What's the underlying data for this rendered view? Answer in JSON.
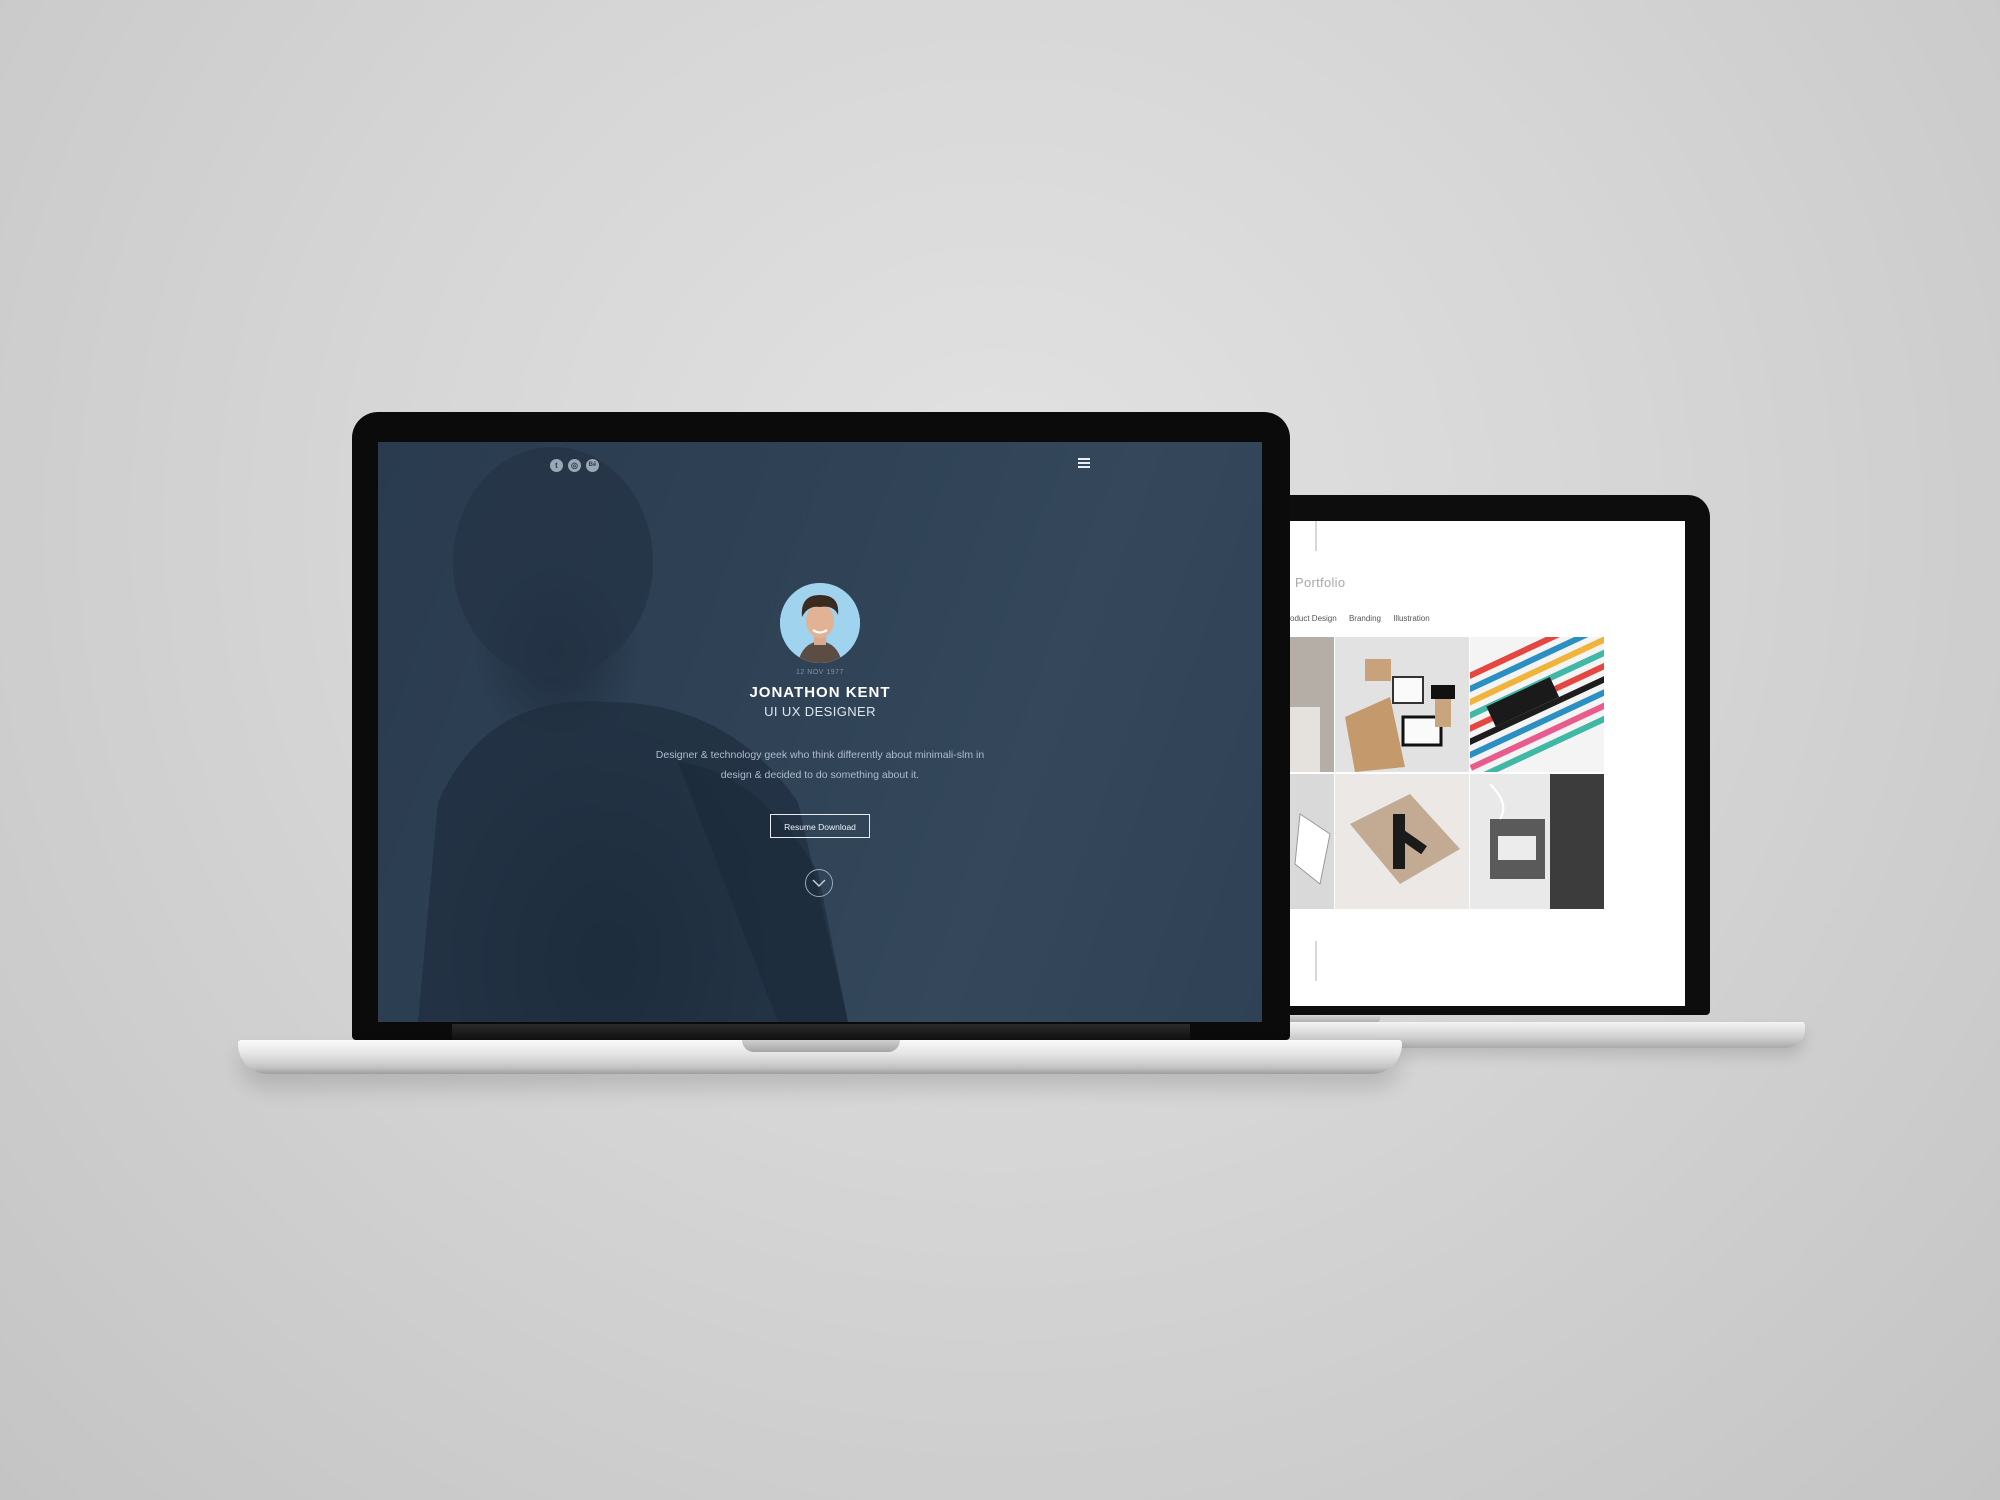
{
  "front": {
    "social_icons": [
      "twitter-icon",
      "dribbble-icon",
      "behance-icon"
    ],
    "social_glyphs": [
      "t",
      "◎",
      "Bē"
    ],
    "menu_icon": "hamburger-menu-icon",
    "profile": {
      "date": "12 NOV 1977",
      "name": "JONATHON KENT",
      "role": "UI UX DESIGNER",
      "bio": "Designer & technology geek who think differently about minimali-slm in design & decided to do something about it."
    },
    "resume_button": "Resume Download",
    "scroll_icon": "chevron-down-icon"
  },
  "back": {
    "section_title": "Portfolio",
    "filters": [
      "Product Design",
      "Branding",
      "Illustration"
    ]
  },
  "colors": {
    "screen_bg": "#2f4256",
    "avatar_bg": "#9fd3ee",
    "page_bg": "#d6d6d6"
  }
}
